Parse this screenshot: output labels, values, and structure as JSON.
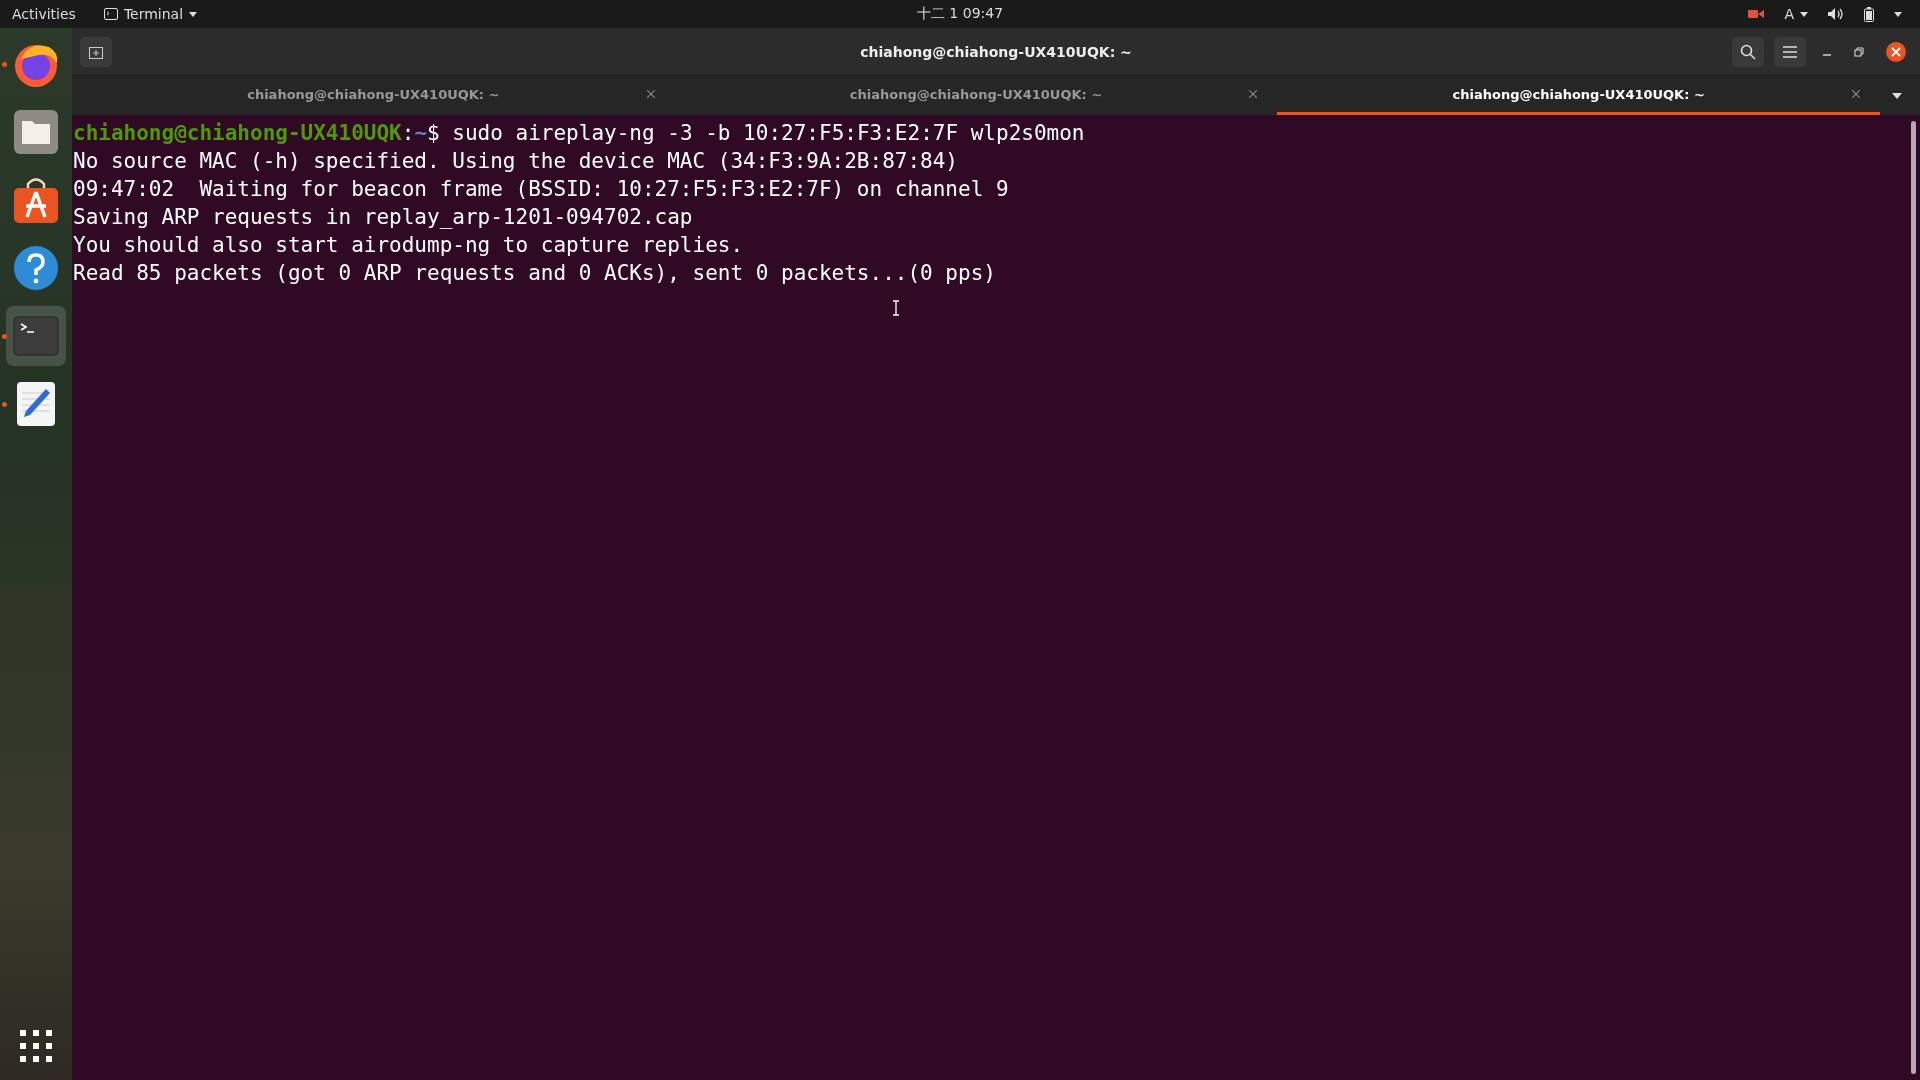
{
  "top_bar": {
    "activities": "Activities",
    "app_menu": "Terminal",
    "clock": "十二 1 09:47",
    "keyboard": "A"
  },
  "dock": {
    "items": [
      {
        "kind": "browser",
        "running": true,
        "selected": false
      },
      {
        "kind": "files",
        "running": false,
        "selected": false
      },
      {
        "kind": "store",
        "running": false,
        "selected": false
      },
      {
        "kind": "help",
        "running": false,
        "selected": false
      },
      {
        "kind": "terminal",
        "running": true,
        "selected": true
      },
      {
        "kind": "editor",
        "running": true,
        "selected": false
      }
    ]
  },
  "window": {
    "title": "chiahong@chiahong-UX410UQK: ~"
  },
  "tabs": [
    {
      "label": "chiahong@chiahong-UX410UQK: ~",
      "selected": false
    },
    {
      "label": "chiahong@chiahong-UX410UQK: ~",
      "selected": false
    },
    {
      "label": "chiahong@chiahong-UX410UQK: ~",
      "selected": true
    }
  ],
  "terminal": {
    "prompt": {
      "user_host": "chiahong@chiahong-UX410UQK",
      "separator": ":",
      "path": "~",
      "command": "$ sudo aireplay-ng -3 -b 10:27:F5:F3:E2:7F wlp2s0mon"
    },
    "output": [
      "No source MAC (-h) specified. Using the device MAC (34:F3:9A:2B:87:84)",
      "09:47:02  Waiting for beacon frame (BSSID: 10:27:F5:F3:E2:7F) on channel 9",
      "Saving ARP requests in replay_arp-1201-094702.cap",
      "You should also start airodump-ng to capture replies.",
      "Read 85 packets (got 0 ARP requests and 0 ACKs), sent 0 packets...(0 pps)"
    ]
  }
}
